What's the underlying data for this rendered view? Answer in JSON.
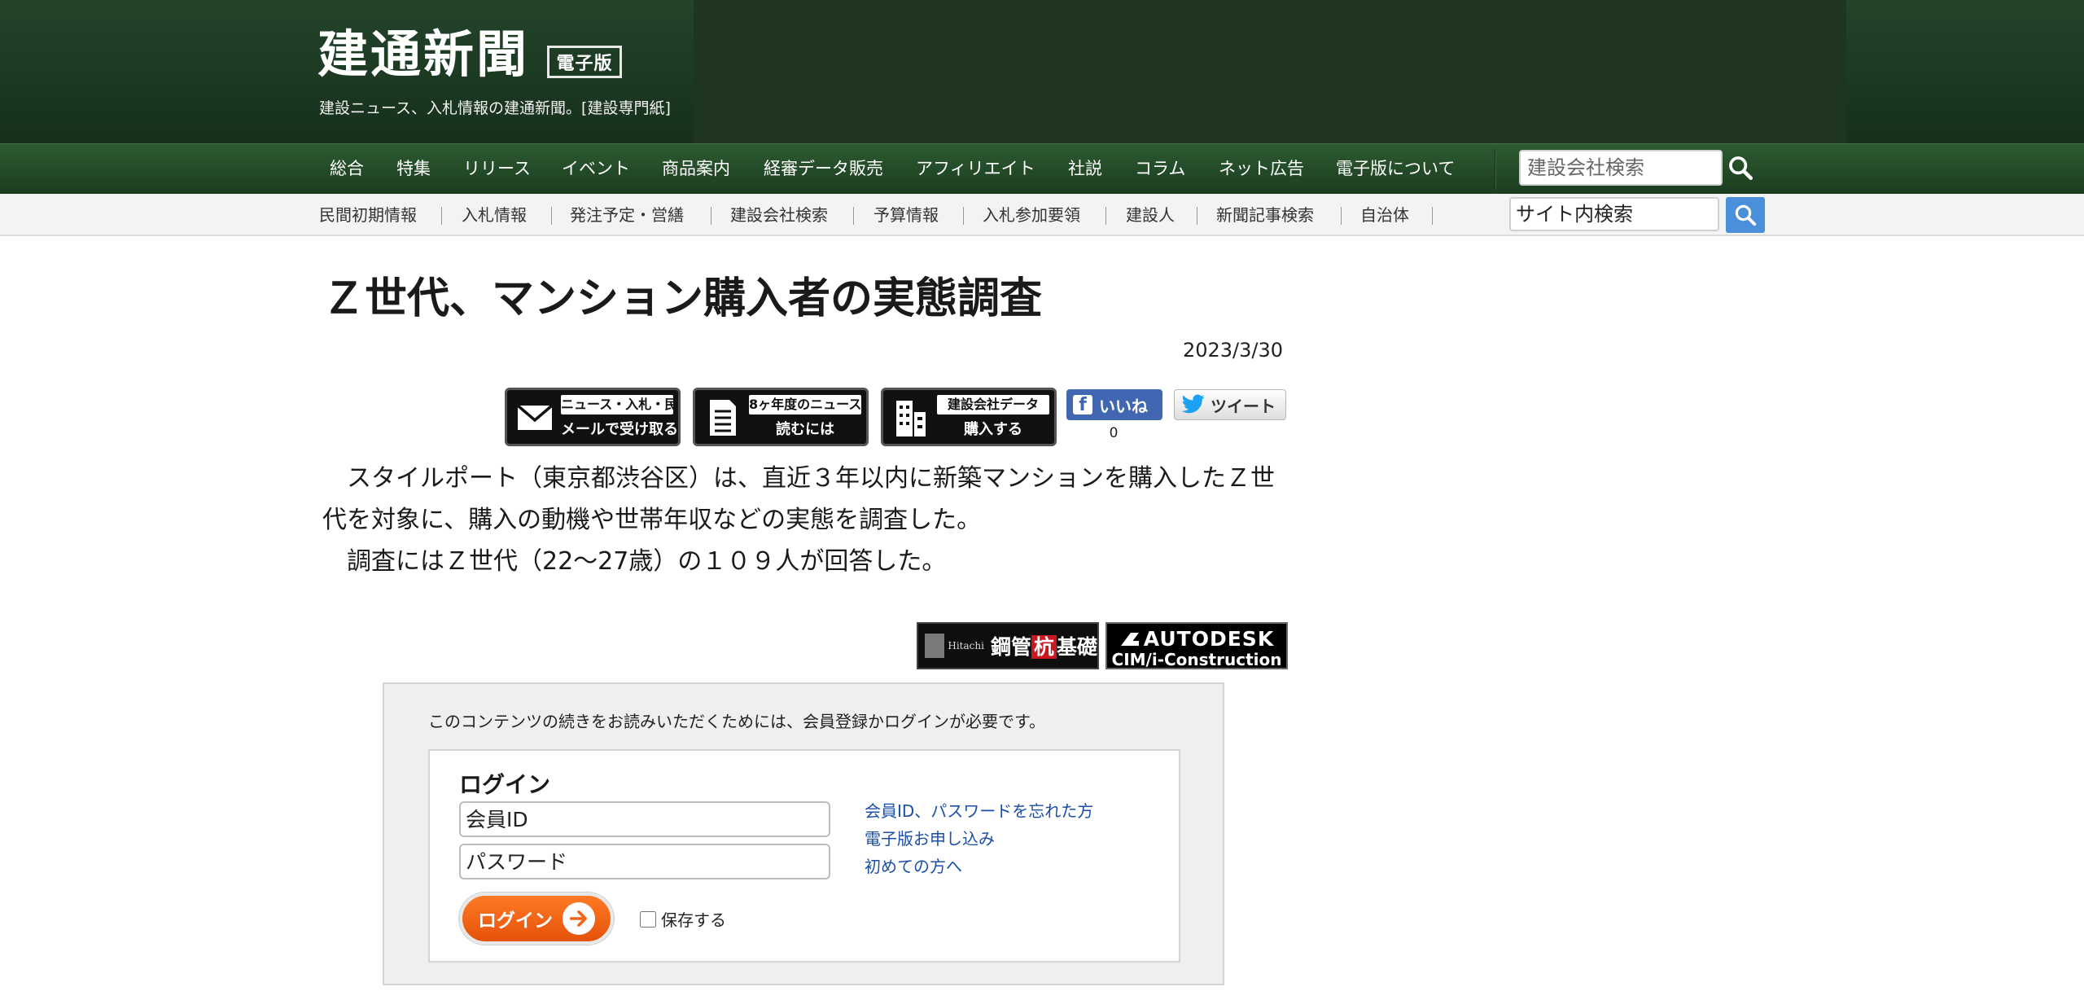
{
  "header": {
    "site_title": "建通新聞",
    "edition_badge": "電子版",
    "tagline": "建設ニュース、入札情報の建通新聞。[建設専門紙]"
  },
  "main_nav": {
    "items": [
      "総合",
      "特集",
      "リリース",
      "イベント",
      "商品案内",
      "経審データ販売",
      "アフィリエイト",
      "社説",
      "コラム",
      "ネット広告",
      "電子版について"
    ],
    "company_search_placeholder": "建設会社検索"
  },
  "sub_nav": {
    "items": [
      "民間初期情報",
      "入札情報",
      "発注予定・営繕",
      "建設会社検索",
      "予算情報",
      "入札参加要領",
      "建設人",
      "新聞記事検索",
      "自治体"
    ],
    "site_search_placeholder": "サイト内検索"
  },
  "article": {
    "title": "Ｚ世代、マンション購入者の実態調査",
    "date": "2023/3/30",
    "action_buttons": [
      {
        "top": "ニュース・入札・民間",
        "bottom": "メールで受け取る",
        "icon": "mail-icon"
      },
      {
        "top": "8ヶ年度のニュース",
        "bottom": "読むには",
        "icon": "document-icon"
      },
      {
        "top": "建設会社データ",
        "bottom": "購入する",
        "icon": "building-icon"
      }
    ],
    "social": {
      "like_label": "いいね",
      "like_count": "0",
      "tweet_label": "ツイート"
    },
    "paragraph1": "　スタイルポート（東京都渋谷区）は、直近３年以内に新築マンションを購入したＺ世代を対象に、購入の動機や世帯年収などの実態を調査した。",
    "paragraph2": "　調査にはＺ世代（22～27歳）の１０９人が回答した。"
  },
  "ads": {
    "hitachi": {
      "small": "Hitachi",
      "main_prefix": "鋼管",
      "main_highlight": "杭",
      "main_suffix": "基礎"
    },
    "autodesk": {
      "line1": "AUTODESK",
      "line2": "CIM/i-Construction"
    }
  },
  "paywall": {
    "note": "このコンテンツの続きをお読みいただくためには、会員登録かログインが必要です。",
    "login_heading": "ログイン",
    "member_id_placeholder": "会員ID",
    "password_placeholder": "パスワード",
    "login_button": "ログイン",
    "remember_label": "保存する",
    "links": [
      "会員ID、パスワードを忘れた方",
      "電子版お申し込み",
      "初めての方へ"
    ]
  },
  "colors": {
    "header_green": "#1f3520",
    "nav_green": "#2d5a31",
    "search_blue": "#4a8fd9",
    "login_orange": "#f26516",
    "link_blue": "#1b4fa8",
    "facebook_blue": "#4267b2"
  }
}
